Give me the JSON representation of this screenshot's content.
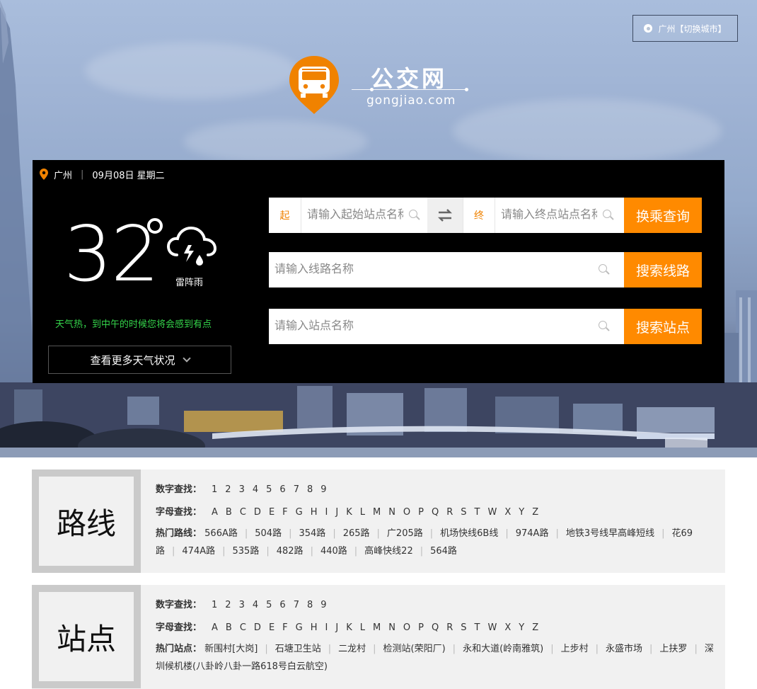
{
  "city_switch": {
    "label": "广州【切换城市】"
  },
  "logo": {
    "title": "公交网",
    "subtitle": "gongjiao.com"
  },
  "panel": {
    "city": "广州",
    "date": "09月08日 星期二",
    "weather": {
      "temperature": "32",
      "condition": "雷阵雨",
      "icon": "thunderstorm-icon",
      "tip": "天气热，到中午的时候您将会感到有点",
      "more_label": "查看更多天气状况"
    },
    "transfer": {
      "start_tag": "起",
      "start_placeholder": "请输入起始站点名称",
      "end_tag": "终",
      "end_placeholder": "请输入终点站点名称",
      "button": "换乘查询"
    },
    "line_search": {
      "placeholder": "请输入线路名称",
      "button": "搜索线路"
    },
    "stop_search": {
      "placeholder": "请输入站点名称",
      "button": "搜索站点"
    }
  },
  "routes": {
    "badge": "路线",
    "digit_label": "数字查找：",
    "digits": [
      "1",
      "2",
      "3",
      "4",
      "5",
      "6",
      "7",
      "8",
      "9"
    ],
    "letter_label": "字母查找：",
    "letters": [
      "A",
      "B",
      "C",
      "D",
      "E",
      "F",
      "G",
      "H",
      "I",
      "J",
      "K",
      "L",
      "M",
      "N",
      "O",
      "P",
      "Q",
      "R",
      "S",
      "T",
      "W",
      "X",
      "Y",
      "Z"
    ],
    "hot_label": "热门路线：",
    "hot": [
      "566A路",
      "504路",
      "354路",
      "265路",
      "广205路",
      "机场快线6B线",
      "974A路",
      "地铁3号线早高峰短线",
      "花69路",
      "474A路",
      "535路",
      "482路",
      "440路",
      "高峰快线22",
      "564路"
    ]
  },
  "stops": {
    "badge": "站点",
    "digit_label": "数字查找：",
    "digits": [
      "1",
      "2",
      "3",
      "4",
      "5",
      "6",
      "7",
      "8",
      "9"
    ],
    "letter_label": "字母查找：",
    "letters": [
      "A",
      "B",
      "C",
      "D",
      "E",
      "F",
      "G",
      "H",
      "I",
      "J",
      "K",
      "L",
      "M",
      "N",
      "O",
      "P",
      "Q",
      "R",
      "S",
      "T",
      "W",
      "X",
      "Y",
      "Z"
    ],
    "hot_label": "热门站点：",
    "hot": [
      "新围村[大岗]",
      "石塘卫生站",
      "二龙村",
      "检测站(荣阳厂)",
      "永和大道(岭南雅筑)",
      "上步村",
      "永盛市场",
      "上扶罗",
      "深圳候机楼(八卦岭八卦一路618号白云航空)"
    ]
  },
  "colors": {
    "accent": "#ff8a00",
    "panel": "#000000",
    "tip": "#34d34a"
  }
}
